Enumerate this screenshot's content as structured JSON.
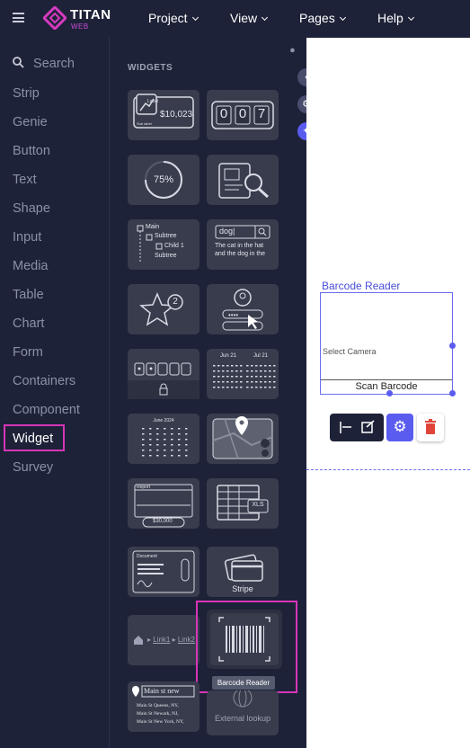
{
  "app": {
    "name": "TITAN",
    "sub": "WEB"
  },
  "menu": [
    "Project",
    "View",
    "Pages",
    "Help"
  ],
  "sidebar": {
    "search": "Search",
    "items": [
      "Strip",
      "Genie",
      "Button",
      "Text",
      "Shape",
      "Input",
      "Media",
      "Table",
      "Chart",
      "Form",
      "Containers",
      "Component",
      "Widget",
      "Survey"
    ],
    "selected": "Widget"
  },
  "panel": {
    "heading": "WIDGETS",
    "tooltip": "Barcode Reader",
    "tiles": {
      "kpi_value": "$10,023",
      "kpi_label": "Label",
      "kpi_sub": "Sub label",
      "counter": [
        "0",
        "0",
        "7"
      ],
      "progress": "75%",
      "tree": [
        "Main",
        "Subtree",
        "Child 1",
        "Subtree"
      ],
      "search_text": "dog|",
      "search_result": "The cat in the hat and the dog in the",
      "rating_count": "2",
      "cal1": "Jun 21",
      "cal2": "Jul 21",
      "cal3": "June   2024",
      "report_title": "Report",
      "report_total": "$30,000",
      "xls": "XLS",
      "document": "Document",
      "stripe": "Stripe",
      "breadcrumb": [
        "Link1",
        "Link2"
      ],
      "address": "Main st new",
      "address_lines": [
        "Main St Queens, NY,",
        "Main St Newark, NJ,",
        "Main St New York, NY,"
      ],
      "external": "External lookup"
    }
  },
  "canvas": {
    "widget_label": "Barcode Reader",
    "select_camera": "Select Camera",
    "scan_button": "Scan Barcode"
  },
  "colors": {
    "bg": "#1e2238",
    "accent": "#5a5cf0",
    "highlight": "#d635b8",
    "delete": "#e0453a"
  }
}
